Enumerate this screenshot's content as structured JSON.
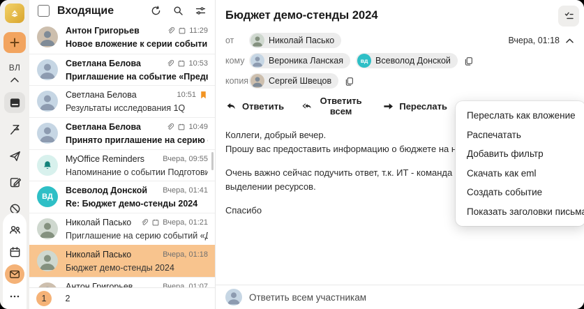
{
  "rail": {
    "initials": "ВЛ"
  },
  "list": {
    "title": "Входящие",
    "rows": [
      {
        "name": "Антон Григорьев",
        "subject": "Новое вложение к серии событий «Аналити...",
        "time": "11:29"
      },
      {
        "name": "Светлана Белова",
        "subject": "Приглашение на событие «Предварительно...",
        "time": "10:53"
      },
      {
        "name": "Светлана Белова",
        "subject": "Результаты исследования 1Q",
        "time": "10:51"
      },
      {
        "name": "Светлана Белова",
        "subject": "Принято приглашение на серию событий «...",
        "time": "10:49"
      },
      {
        "name": "MyOffice Reminders",
        "subject": "Напоминание о событии Подготовить отчет...",
        "time": "Вчера, 09:55"
      },
      {
        "name": "Всеволод Донской",
        "subject": "Re: Бюджет демо-стенды 2024",
        "time": "Вчера, 01:41",
        "initials": "ВД"
      },
      {
        "name": "Николай Пасько",
        "subject": "Приглашение на серию событий «Демо стен...",
        "time": "Вчера, 01:21"
      },
      {
        "name": "Николай Пасько",
        "subject": "Бюджет демо-стенды 2024",
        "time": "Вчера, 01:18"
      },
      {
        "name": "Антон Григорьев",
        "subject": "",
        "time": "Вчера, 01:07"
      }
    ],
    "pagination": {
      "page1": "1",
      "page2": "2"
    }
  },
  "mail": {
    "subject": "Бюджет демо-стенды 2024",
    "date": "Вчера, 01:18",
    "from_label": "от",
    "to_label": "кому",
    "cc_label": "копия",
    "from": {
      "name": "Николай Пасько"
    },
    "to1": {
      "name": "Вероника Ланская"
    },
    "to2": {
      "name": "Всеволод Донской",
      "initials": "вд"
    },
    "cc1": {
      "name": "Сергей Швецов"
    },
    "actions": {
      "reply": "Ответить",
      "reply_all": "Ответить всем",
      "forward": "Переслать"
    },
    "body": {
      "p1": "Коллеги, добрый вечер.",
      "p2": "Прошу вас предоставить информацию о бюджете на наши демонстраци",
      "p3": "Очень важно сейчас подучить ответ, т.к. ИТ - команда Всеволода, уже",
      "p4": "выделении ресурсов.",
      "p5": "Спасибо"
    },
    "reply_placeholder": "Ответить всем участникам"
  },
  "menu": {
    "items": [
      "Переслать как вложение",
      "Распечатать",
      "Добавить фильтр",
      "Скачать как eml",
      "Создать событие",
      "Показать заголовки письма"
    ]
  },
  "colors": {
    "accent": "#f2a45f",
    "selected_row": "#f8c48e",
    "teal": "#2ebfc6",
    "bookmark": "#f29422"
  }
}
